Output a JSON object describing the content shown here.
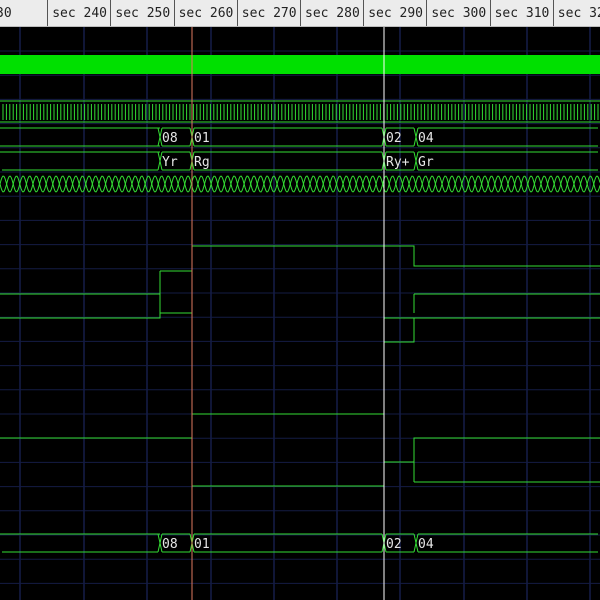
{
  "timeline": {
    "labels": [
      "30",
      "sec 240",
      "sec 250",
      "sec 260",
      "sec 270",
      "sec 280",
      "sec 290",
      "sec 300",
      "sec 310",
      "sec 320",
      "s"
    ]
  },
  "markers": [
    {
      "name": "marker-red",
      "color": "#e07a5f"
    },
    {
      "name": "marker-white",
      "color": "#ffffff"
    }
  ],
  "colors": {
    "background": "#000000",
    "grid": "#1f2c6e",
    "trace": "#33dd33",
    "clock_bar": "#00e000",
    "text": "#e6e6e6",
    "ruler": "#ececec"
  },
  "traces": {
    "bus_top_values": [
      "08",
      "01",
      "02",
      "04"
    ],
    "state_values": [
      "Yr",
      "Rg",
      "Ry+",
      "Gr"
    ],
    "bus_bottom_values": [
      "08",
      "01",
      "02",
      "04"
    ]
  }
}
